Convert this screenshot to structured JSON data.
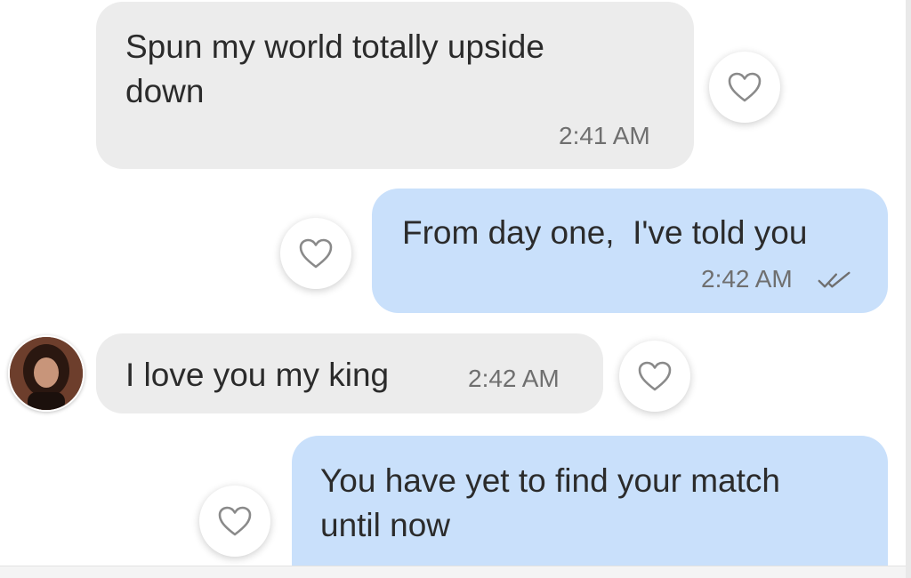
{
  "messages": [
    {
      "direction": "incoming",
      "text": "Spun my world totally upside down",
      "line1": "Spun my world totally upside",
      "line2": "down",
      "time": "2:41 AM"
    },
    {
      "direction": "outgoing",
      "text": "From day one,  I've told you",
      "time": "2:42 AM",
      "status": "read-double-check-icon"
    },
    {
      "direction": "incoming",
      "text": "I love you my king",
      "time": "2:42 AM",
      "sender_avatar": "avatar"
    },
    {
      "direction": "outgoing",
      "text": "You have yet to find your match until now",
      "line1": "You have yet to find your match",
      "line2": "until now",
      "status": "read-double-check-icon"
    }
  ],
  "colors": {
    "incoming_bubble": "#ececec",
    "outgoing_bubble": "#c9e0fb",
    "text": "#2b2b2b",
    "timestamp": "#6f6f6f",
    "heart_outline": "#8a8a8a"
  },
  "icons": {
    "like": "heart-outline-icon",
    "read": "double-check-icon"
  }
}
